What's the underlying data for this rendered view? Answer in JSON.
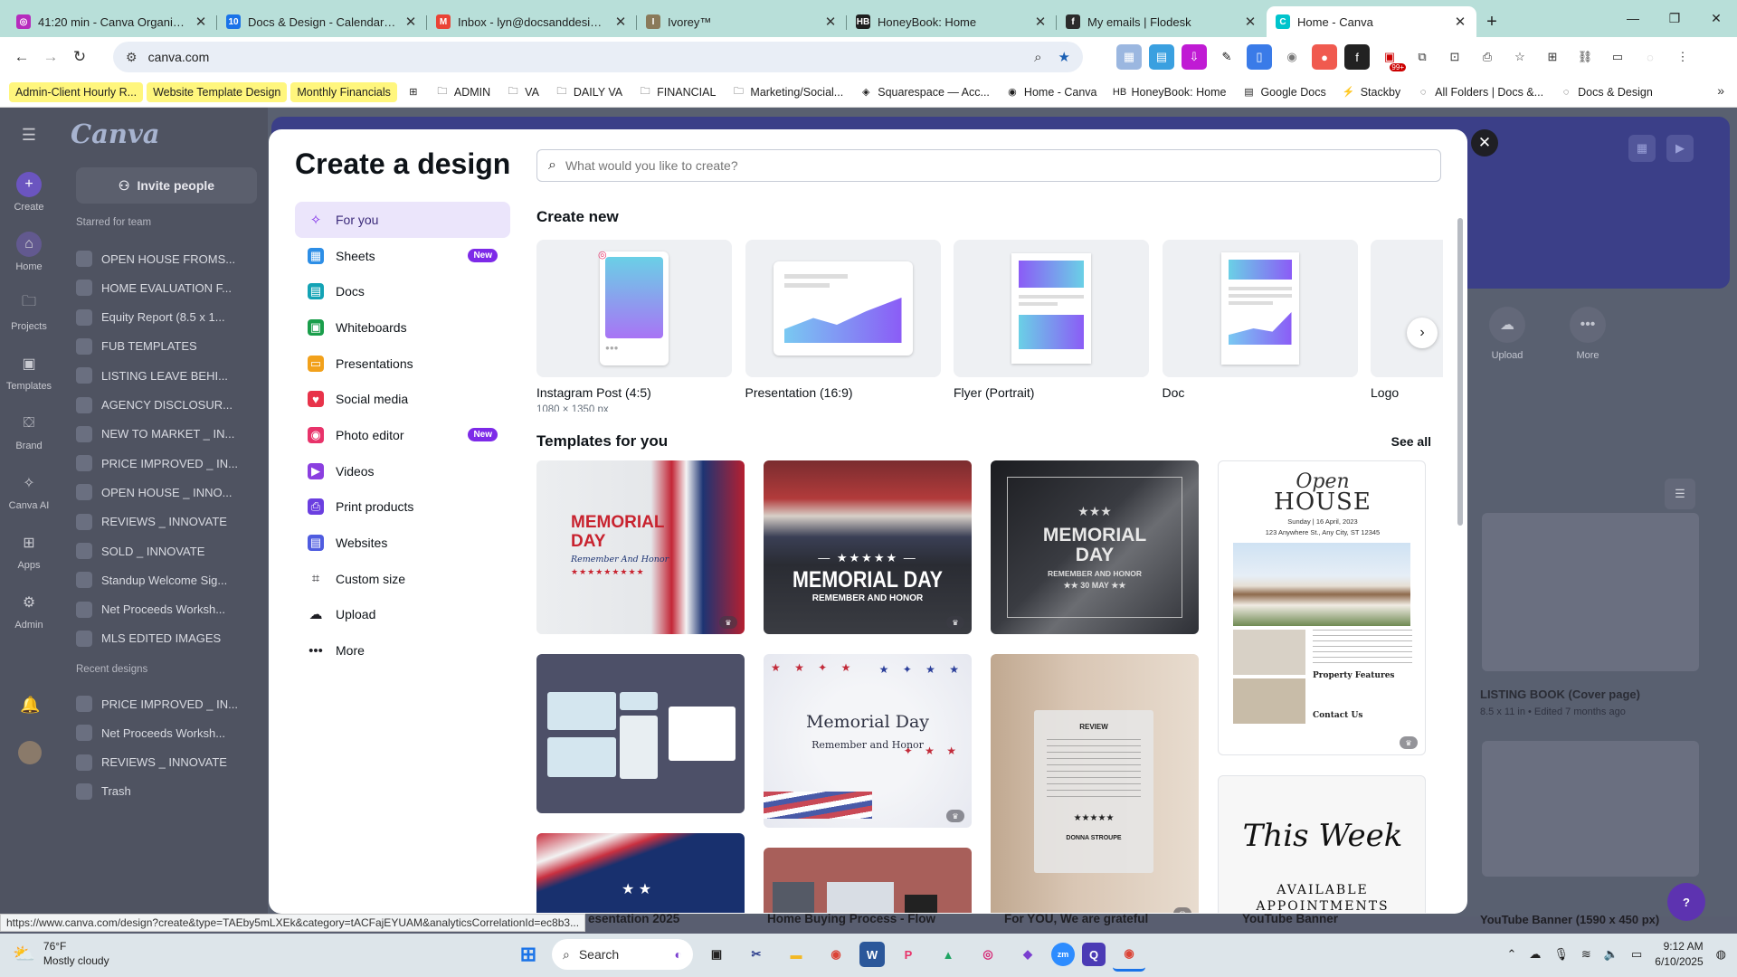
{
  "browser": {
    "tabs": [
      {
        "title": "41:20 min - Canva Organization",
        "favicon_color": "#b62bbd",
        "favicon_text": "◎"
      },
      {
        "title": "Docs & Design - Calendar - Week",
        "favicon_color": "#1a73e8",
        "favicon_text": "10"
      },
      {
        "title": "Inbox - lyn@docsanddesign.com",
        "favicon_color": "#ea4335",
        "favicon_text": "M"
      },
      {
        "title": "Ivorey™",
        "favicon_color": "#8a7a5a",
        "favicon_text": "I"
      },
      {
        "title": "HoneyBook: Home",
        "favicon_color": "#1f1f1f",
        "favicon_text": "HB"
      },
      {
        "title": "My emails | Flodesk",
        "favicon_color": "#2b2b2b",
        "favicon_text": "f"
      },
      {
        "title": "Home - Canva",
        "favicon_color": "#00c4cc",
        "favicon_text": "C"
      }
    ],
    "url": "canva.com",
    "bookmarks": [
      {
        "label": "Admin-Client Hourly R...",
        "highlight": true,
        "icon": ""
      },
      {
        "label": "Website Template Design",
        "highlight": true,
        "icon": ""
      },
      {
        "label": "Monthly Financials",
        "highlight": true,
        "icon": ""
      },
      {
        "label": "",
        "highlight": false,
        "icon": "grid-icon"
      },
      {
        "label": "ADMIN",
        "highlight": false,
        "icon": "folder-icon"
      },
      {
        "label": "VA",
        "highlight": false,
        "icon": "folder-icon"
      },
      {
        "label": "DAILY VA",
        "highlight": false,
        "icon": "folder-icon"
      },
      {
        "label": "FINANCIAL",
        "highlight": false,
        "icon": "folder-icon"
      },
      {
        "label": "Marketing/Social...",
        "highlight": false,
        "icon": "folder-icon"
      },
      {
        "label": "Squarespace — Acc...",
        "highlight": false,
        "icon": "squarespace-icon"
      },
      {
        "label": "Home - Canva",
        "highlight": false,
        "icon": "canva-icon"
      },
      {
        "label": "HoneyBook: Home",
        "highlight": false,
        "icon": "honeybook-icon"
      },
      {
        "label": "Google Docs",
        "highlight": false,
        "icon": "docs-icon"
      },
      {
        "label": "Stackby",
        "highlight": false,
        "icon": "stackby-icon"
      },
      {
        "label": "All Folders | Docs &...",
        "highlight": false,
        "icon": "ivorey-icon"
      },
      {
        "label": "Docs & Design",
        "highlight": false,
        "icon": "ivorey-icon"
      }
    ],
    "ext_badge": "99+",
    "status_url": "https://www.canva.com/design?create&type=TAEby5mLXEk&category=tACFajEYUAM&analyticsCorrelationId=ec8b3..."
  },
  "canva": {
    "rail": [
      "Create",
      "Home",
      "Projects",
      "Templates",
      "Brand",
      "Canva AI",
      "Apps",
      "Admin"
    ],
    "invite_label": "Invite people",
    "starred_header": "Starred for team",
    "starred": [
      "OPEN HOUSE FROMS...",
      "HOME EVALUATION F...",
      "Equity Report (8.5 x 1...",
      "FUB TEMPLATES",
      "LISTING LEAVE BEHI...",
      "AGENCY DISCLOSUR...",
      "NEW TO MARKET _ IN...",
      "PRICE IMPROVED _ IN...",
      "OPEN HOUSE _ INNO...",
      "REVIEWS _ INNOVATE",
      "SOLD _ INNOVATE",
      "Standup Welcome Sig...",
      "Net Proceeds Worksh...",
      "MLS EDITED IMAGES"
    ],
    "recent_header": "Recent designs",
    "recent": [
      "PRICE IMPROVED _ IN...",
      "Net Proceeds Worksh...",
      "REVIEWS _ INNOVATE",
      "Trash"
    ],
    "right_panel": {
      "upload": "Upload",
      "more": "More",
      "design1_title": "LISTING BOOK (Cover page)",
      "design1_meta": "8.5 x 11 in • Edited 7 months ago",
      "design2_title": "YouTube Banner (1590 x 450 px)"
    },
    "under_labels": [
      "esentation 2025",
      "Home Buying Process - Flow",
      "For YOU, We are grateful",
      "YouTube Banner"
    ]
  },
  "modal": {
    "title": "Create a design",
    "search_placeholder": "What would you like to create?",
    "menu": [
      {
        "label": "For you",
        "icon": "sparkle-icon",
        "color": "#7d2ae8",
        "badge": ""
      },
      {
        "label": "Sheets",
        "icon": "sheets-icon",
        "color": "#2d8ee6",
        "badge": "New"
      },
      {
        "label": "Docs",
        "icon": "docs-icon",
        "color": "#13a3b5",
        "badge": ""
      },
      {
        "label": "Whiteboards",
        "icon": "whiteboard-icon",
        "color": "#1a9e4b",
        "badge": ""
      },
      {
        "label": "Presentations",
        "icon": "presentation-icon",
        "color": "#f2a11b",
        "badge": ""
      },
      {
        "label": "Social media",
        "icon": "heart-icon",
        "color": "#e8334a",
        "badge": ""
      },
      {
        "label": "Photo editor",
        "icon": "camera-icon",
        "color": "#e8336a",
        "badge": "New"
      },
      {
        "label": "Videos",
        "icon": "video-icon",
        "color": "#8b3fe0",
        "badge": ""
      },
      {
        "label": "Print products",
        "icon": "print-icon",
        "color": "#6b3fe0",
        "badge": ""
      },
      {
        "label": "Websites",
        "icon": "website-icon",
        "color": "#4f5ce0",
        "badge": ""
      },
      {
        "label": "Custom size",
        "icon": "crop-icon",
        "color": "#1f1f24",
        "badge": ""
      },
      {
        "label": "Upload",
        "icon": "cloud-upload-icon",
        "color": "#1f1f24",
        "badge": ""
      },
      {
        "label": "More",
        "icon": "more-dots-icon",
        "color": "#1f1f24",
        "badge": ""
      }
    ],
    "create_new_heading": "Create new",
    "create_new": [
      {
        "name": "Instagram Post (4:5)",
        "sub": "1080 × 1350 px"
      },
      {
        "name": "Presentation (16:9)",
        "sub": ""
      },
      {
        "name": "Flyer (Portrait)",
        "sub": ""
      },
      {
        "name": "Doc",
        "sub": ""
      },
      {
        "name": "Logo",
        "sub": ""
      }
    ],
    "templates_heading": "Templates for you",
    "see_all": "See all",
    "templates": {
      "t1_big": "MEMORIAL\nDAY",
      "t1_script": "Remember And Honor",
      "t2_big": "MEMORIAL DAY",
      "t2_sub": "REMEMBER AND HONOR",
      "t3_big": "MEMORIAL\nDAY",
      "t3_sub": "REMEMBER AND HONOR",
      "t3_date": "★★ 30 MAY ★★",
      "t4_script": "Open",
      "t4_big": "HOUSE",
      "t4_date": "Sunday | 16 April, 2023",
      "t4_addr": "123 Anywhere St., Any City, ST 12345",
      "t4_features": "Property Features",
      "t4_contact": "Contact Us",
      "t6_big": "Memorial Day",
      "t6_sub": "Remember and Honor",
      "t7_review": "REVIEW",
      "t7_name": "DONNA STROUPE",
      "t7_stars": "★★★★★",
      "t8_big": "This Week",
      "t8_sub": "AVAILABLE",
      "t8_sub2": "APPOINTMENTS"
    }
  },
  "taskbar": {
    "temp": "76°F",
    "weather": "Mostly cloudy",
    "search": "Search",
    "time": "9:12 AM",
    "date": "6/10/2025"
  }
}
